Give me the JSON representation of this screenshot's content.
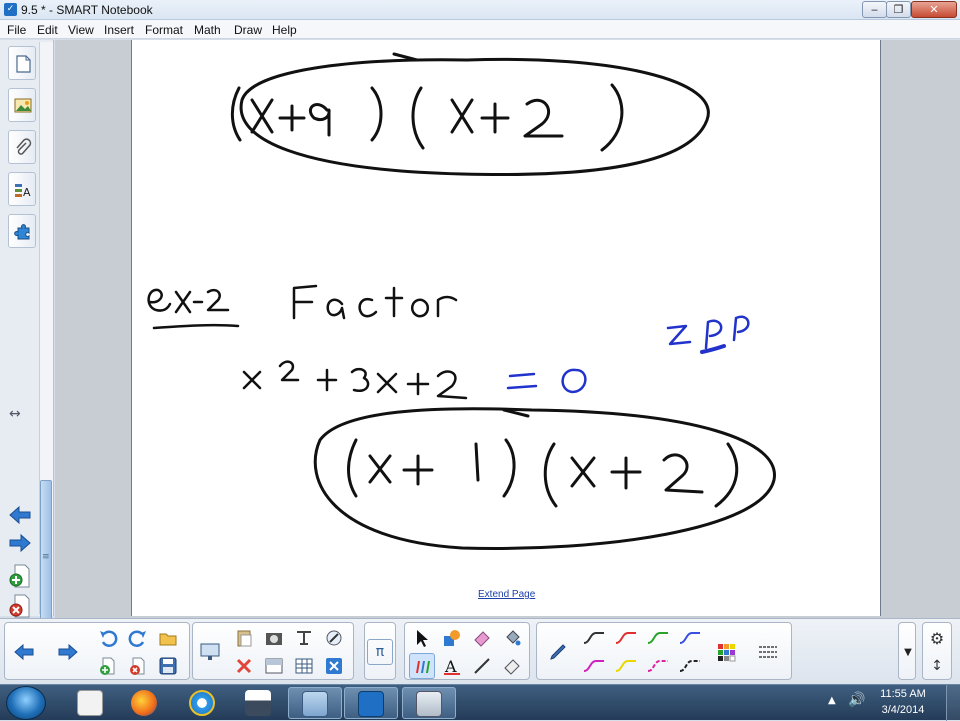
{
  "window": {
    "title": "9.5 * - SMART Notebook",
    "minimize_glyph": "‒",
    "maximize_glyph": "❐",
    "close_glyph": "✕"
  },
  "menu": {
    "items": [
      "File",
      "Edit",
      "View",
      "Insert",
      "Format",
      "Math",
      "Draw",
      "Help"
    ]
  },
  "sidebar": {
    "tabs": [
      "page-sorter-icon",
      "gallery-icon",
      "attachments-icon",
      "properties-icon",
      "add-ons-icon"
    ],
    "resize_glyph": "↔",
    "grip_glyph": "≡"
  },
  "canvas": {
    "extend_link": "Extend Page",
    "handwriting": {
      "line1": "(x+9)(x+2)",
      "ex_label": "ex-2",
      "heading": "Factor",
      "equation_black": "x² + 3x + 2",
      "equation_blue": "= 0",
      "note_blue": "ZPP",
      "answer": "(x+1)(x+2)"
    },
    "colors": {
      "ink_black": "#111111",
      "ink_blue": "#2233cc"
    }
  },
  "toolbar": {
    "pi_glyph": "π",
    "pen_colors": [
      "#333333",
      "#e03030",
      "#29a329",
      "#3a4ee0",
      "#d020c0",
      "#e8d800",
      "#e020a0",
      "#222222"
    ]
  },
  "taskbar": {
    "time": "11:55 AM",
    "date": "3/4/2014",
    "tray_arrow": "▲",
    "volume_glyph": "🔊"
  }
}
